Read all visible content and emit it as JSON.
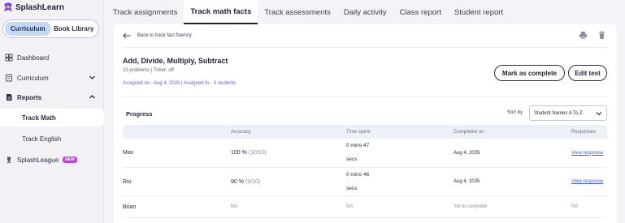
{
  "brand": {
    "name": "SplashLearn"
  },
  "sidebar": {
    "segment": {
      "curriculum": "Curriculum",
      "library": "Book Library"
    },
    "items": {
      "dashboard": "Dashboard",
      "curriculum": "Curriculum",
      "reports": "Reports",
      "track_math": "Track Math",
      "track_english": "Track English",
      "splashleague": "SplashLeague",
      "new_badge": "NEW"
    }
  },
  "tabs": [
    "Track assignments",
    "Track math facts",
    "Track assessments",
    "Daily activity",
    "Class report",
    "Student report"
  ],
  "header": {
    "back_label": "Back to track fact fluency",
    "title": "Add, Divide, Multiply, Subtract",
    "meta": "10 problems | Timer: off",
    "assigned": "Assigned on - Aug 4, 2025 | Assigned to - 3 students",
    "mark_complete": "Mark as complete",
    "edit_test": "Edit test"
  },
  "progress": {
    "label": "Progress",
    "sort_by": "Sort by",
    "sort_value": "Student Names A To Z",
    "columns": [
      "Accuracy",
      "Time spent",
      "Completed on",
      "Responses"
    ],
    "rows": [
      {
        "name": "Max",
        "acc_pct": "100 %",
        "acc_detail": "(10/10)",
        "time_1": "0 mins 47",
        "time_2": "secs",
        "completed": "Aug 4, 2025",
        "response": "View response"
      },
      {
        "name": "Rio",
        "acc_pct": "90 %",
        "acc_detail": "(9/10)",
        "time_1": "0 mins 46",
        "time_2": "secs",
        "completed": "Aug 4, 2025",
        "response": "View response"
      },
      {
        "name": "Brian",
        "acc_na": "NA",
        "time_na": "NA",
        "completed": "Yet to complete",
        "response": "NA"
      }
    ]
  },
  "colors": {
    "accent": "#6b56d8",
    "active_segment": "#c5d8f8",
    "link": "#3b5bdb",
    "new_badge": "#c13fe4"
  }
}
